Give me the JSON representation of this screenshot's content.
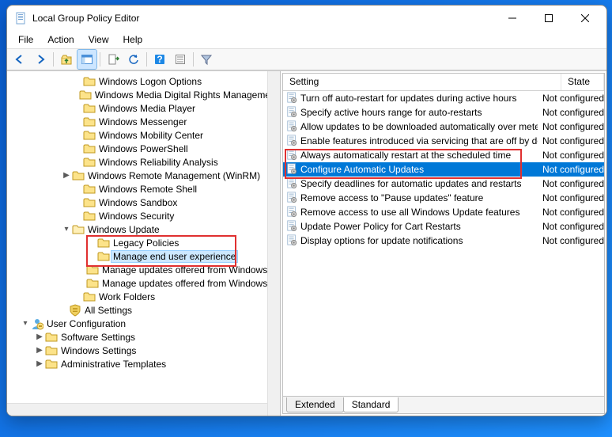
{
  "window": {
    "title": "Local Group Policy Editor"
  },
  "menubar": {
    "file": "File",
    "action": "Action",
    "view": "View",
    "help": "Help"
  },
  "tree": {
    "nodes": [
      {
        "indent": 82,
        "twisty": "",
        "icon": "folder",
        "label": "Windows Logon Options"
      },
      {
        "indent": 82,
        "twisty": "",
        "icon": "folder",
        "label": "Windows Media Digital Rights Management"
      },
      {
        "indent": 82,
        "twisty": "",
        "icon": "folder",
        "label": "Windows Media Player"
      },
      {
        "indent": 82,
        "twisty": "",
        "icon": "folder",
        "label": "Windows Messenger"
      },
      {
        "indent": 82,
        "twisty": "",
        "icon": "folder",
        "label": "Windows Mobility Center"
      },
      {
        "indent": 82,
        "twisty": "",
        "icon": "folder",
        "label": "Windows PowerShell"
      },
      {
        "indent": 82,
        "twisty": "",
        "icon": "folder",
        "label": "Windows Reliability Analysis"
      },
      {
        "indent": 68,
        "twisty": ">",
        "icon": "folder",
        "label": "Windows Remote Management (WinRM)"
      },
      {
        "indent": 82,
        "twisty": "",
        "icon": "folder",
        "label": "Windows Remote Shell"
      },
      {
        "indent": 82,
        "twisty": "",
        "icon": "folder",
        "label": "Windows Sandbox"
      },
      {
        "indent": 82,
        "twisty": "",
        "icon": "folder",
        "label": "Windows Security"
      },
      {
        "indent": 68,
        "twisty": "v",
        "icon": "folder",
        "label": "Windows Update",
        "open": true
      },
      {
        "indent": 100,
        "twisty": "",
        "icon": "folder",
        "label": "Legacy Policies"
      },
      {
        "indent": 100,
        "twisty": "",
        "icon": "folder",
        "label": "Manage end user experience",
        "selected": true
      },
      {
        "indent": 100,
        "twisty": "",
        "icon": "folder",
        "label": "Manage updates offered from Windows Server Update Service"
      },
      {
        "indent": 100,
        "twisty": "",
        "icon": "folder",
        "label": "Manage updates offered from Windows Update"
      },
      {
        "indent": 82,
        "twisty": "",
        "icon": "folder",
        "label": "Work Folders"
      },
      {
        "indent": 64,
        "twisty": "",
        "icon": "shield",
        "label": "All Settings"
      },
      {
        "indent": 16,
        "twisty": "v",
        "icon": "user",
        "label": "User Configuration",
        "open": true
      },
      {
        "indent": 34,
        "twisty": ">",
        "icon": "folder",
        "label": "Software Settings"
      },
      {
        "indent": 34,
        "twisty": ">",
        "icon": "folder",
        "label": "Windows Settings"
      },
      {
        "indent": 34,
        "twisty": ">",
        "icon": "folder",
        "label": "Administrative Templates"
      }
    ]
  },
  "list": {
    "headers": {
      "setting": "Setting",
      "state": "State"
    },
    "rows": [
      {
        "setting": "Turn off auto-restart for updates during active hours",
        "state": "Not configured"
      },
      {
        "setting": "Specify active hours range for auto-restarts",
        "state": "Not configured"
      },
      {
        "setting": "Allow updates to be downloaded automatically over metere...",
        "state": "Not configured"
      },
      {
        "setting": "Enable features introduced via servicing that are off by default",
        "state": "Not configured"
      },
      {
        "setting": "Always automatically restart at the scheduled time",
        "state": "Not configured"
      },
      {
        "setting": "Configure Automatic Updates",
        "state": "Not configured",
        "selected": true
      },
      {
        "setting": "Specify deadlines for automatic updates and restarts",
        "state": "Not configured"
      },
      {
        "setting": "Remove access to \"Pause updates\" feature",
        "state": "Not configured"
      },
      {
        "setting": "Remove access to use all Windows Update features",
        "state": "Not configured"
      },
      {
        "setting": "Update Power Policy for Cart Restarts",
        "state": "Not configured"
      },
      {
        "setting": "Display options for update notifications",
        "state": "Not configured"
      }
    ]
  },
  "tabs": {
    "extended": "Extended",
    "standard": "Standard"
  }
}
